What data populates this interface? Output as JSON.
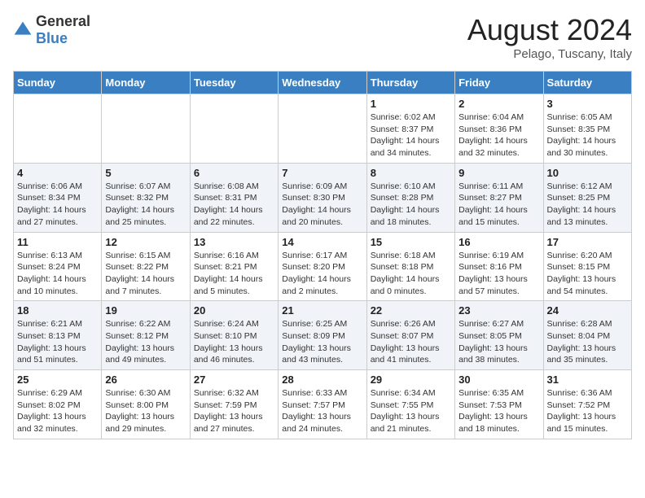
{
  "logo": {
    "general": "General",
    "blue": "Blue"
  },
  "header": {
    "month_year": "August 2024",
    "location": "Pelago, Tuscany, Italy"
  },
  "days_of_week": [
    "Sunday",
    "Monday",
    "Tuesday",
    "Wednesday",
    "Thursday",
    "Friday",
    "Saturday"
  ],
  "weeks": [
    [
      {
        "day": "",
        "info": ""
      },
      {
        "day": "",
        "info": ""
      },
      {
        "day": "",
        "info": ""
      },
      {
        "day": "",
        "info": ""
      },
      {
        "day": "1",
        "info": "Sunrise: 6:02 AM\nSunset: 8:37 PM\nDaylight: 14 hours\nand 34 minutes."
      },
      {
        "day": "2",
        "info": "Sunrise: 6:04 AM\nSunset: 8:36 PM\nDaylight: 14 hours\nand 32 minutes."
      },
      {
        "day": "3",
        "info": "Sunrise: 6:05 AM\nSunset: 8:35 PM\nDaylight: 14 hours\nand 30 minutes."
      }
    ],
    [
      {
        "day": "4",
        "info": "Sunrise: 6:06 AM\nSunset: 8:34 PM\nDaylight: 14 hours\nand 27 minutes."
      },
      {
        "day": "5",
        "info": "Sunrise: 6:07 AM\nSunset: 8:32 PM\nDaylight: 14 hours\nand 25 minutes."
      },
      {
        "day": "6",
        "info": "Sunrise: 6:08 AM\nSunset: 8:31 PM\nDaylight: 14 hours\nand 22 minutes."
      },
      {
        "day": "7",
        "info": "Sunrise: 6:09 AM\nSunset: 8:30 PM\nDaylight: 14 hours\nand 20 minutes."
      },
      {
        "day": "8",
        "info": "Sunrise: 6:10 AM\nSunset: 8:28 PM\nDaylight: 14 hours\nand 18 minutes."
      },
      {
        "day": "9",
        "info": "Sunrise: 6:11 AM\nSunset: 8:27 PM\nDaylight: 14 hours\nand 15 minutes."
      },
      {
        "day": "10",
        "info": "Sunrise: 6:12 AM\nSunset: 8:25 PM\nDaylight: 14 hours\nand 13 minutes."
      }
    ],
    [
      {
        "day": "11",
        "info": "Sunrise: 6:13 AM\nSunset: 8:24 PM\nDaylight: 14 hours\nand 10 minutes."
      },
      {
        "day": "12",
        "info": "Sunrise: 6:15 AM\nSunset: 8:22 PM\nDaylight: 14 hours\nand 7 minutes."
      },
      {
        "day": "13",
        "info": "Sunrise: 6:16 AM\nSunset: 8:21 PM\nDaylight: 14 hours\nand 5 minutes."
      },
      {
        "day": "14",
        "info": "Sunrise: 6:17 AM\nSunset: 8:20 PM\nDaylight: 14 hours\nand 2 minutes."
      },
      {
        "day": "15",
        "info": "Sunrise: 6:18 AM\nSunset: 8:18 PM\nDaylight: 14 hours\nand 0 minutes."
      },
      {
        "day": "16",
        "info": "Sunrise: 6:19 AM\nSunset: 8:16 PM\nDaylight: 13 hours\nand 57 minutes."
      },
      {
        "day": "17",
        "info": "Sunrise: 6:20 AM\nSunset: 8:15 PM\nDaylight: 13 hours\nand 54 minutes."
      }
    ],
    [
      {
        "day": "18",
        "info": "Sunrise: 6:21 AM\nSunset: 8:13 PM\nDaylight: 13 hours\nand 51 minutes."
      },
      {
        "day": "19",
        "info": "Sunrise: 6:22 AM\nSunset: 8:12 PM\nDaylight: 13 hours\nand 49 minutes."
      },
      {
        "day": "20",
        "info": "Sunrise: 6:24 AM\nSunset: 8:10 PM\nDaylight: 13 hours\nand 46 minutes."
      },
      {
        "day": "21",
        "info": "Sunrise: 6:25 AM\nSunset: 8:09 PM\nDaylight: 13 hours\nand 43 minutes."
      },
      {
        "day": "22",
        "info": "Sunrise: 6:26 AM\nSunset: 8:07 PM\nDaylight: 13 hours\nand 41 minutes."
      },
      {
        "day": "23",
        "info": "Sunrise: 6:27 AM\nSunset: 8:05 PM\nDaylight: 13 hours\nand 38 minutes."
      },
      {
        "day": "24",
        "info": "Sunrise: 6:28 AM\nSunset: 8:04 PM\nDaylight: 13 hours\nand 35 minutes."
      }
    ],
    [
      {
        "day": "25",
        "info": "Sunrise: 6:29 AM\nSunset: 8:02 PM\nDaylight: 13 hours\nand 32 minutes."
      },
      {
        "day": "26",
        "info": "Sunrise: 6:30 AM\nSunset: 8:00 PM\nDaylight: 13 hours\nand 29 minutes."
      },
      {
        "day": "27",
        "info": "Sunrise: 6:32 AM\nSunset: 7:59 PM\nDaylight: 13 hours\nand 27 minutes."
      },
      {
        "day": "28",
        "info": "Sunrise: 6:33 AM\nSunset: 7:57 PM\nDaylight: 13 hours\nand 24 minutes."
      },
      {
        "day": "29",
        "info": "Sunrise: 6:34 AM\nSunset: 7:55 PM\nDaylight: 13 hours\nand 21 minutes."
      },
      {
        "day": "30",
        "info": "Sunrise: 6:35 AM\nSunset: 7:53 PM\nDaylight: 13 hours\nand 18 minutes."
      },
      {
        "day": "31",
        "info": "Sunrise: 6:36 AM\nSunset: 7:52 PM\nDaylight: 13 hours\nand 15 minutes."
      }
    ]
  ]
}
